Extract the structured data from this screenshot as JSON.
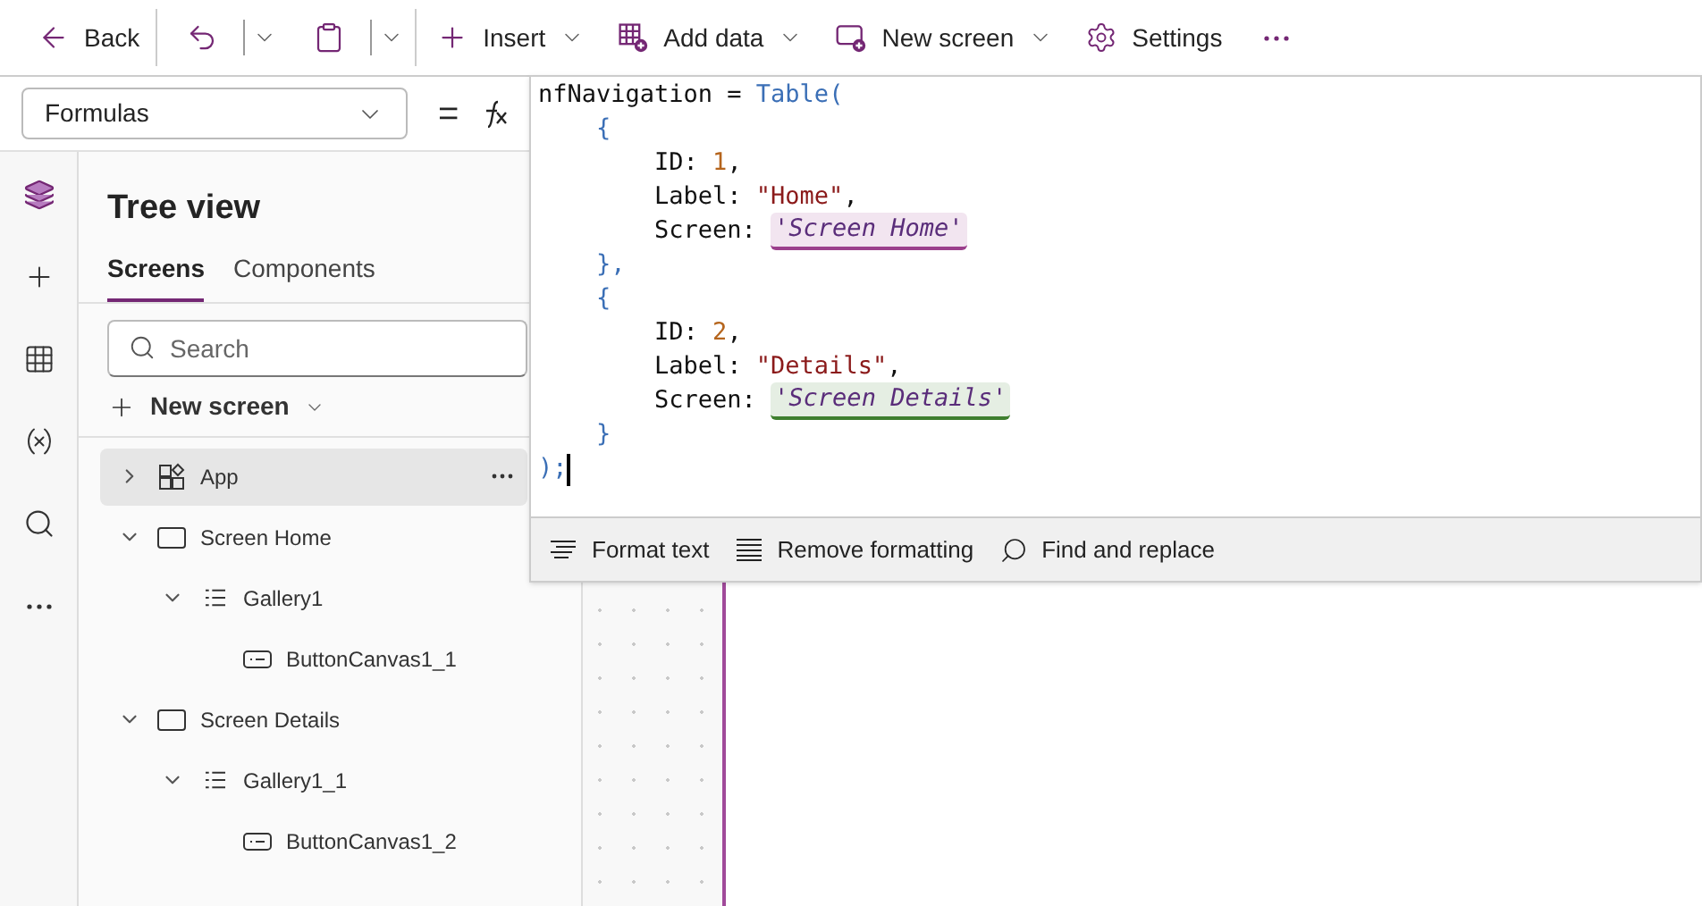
{
  "toolbar": [
    {
      "kind": "back",
      "label": "Back",
      "dropdown": false,
      "separator_after": true
    },
    {
      "kind": "undo",
      "dropdown": true,
      "separator_after": false
    },
    {
      "kind": "paste",
      "dropdown": true,
      "separator_after": true
    },
    {
      "kind": "insert",
      "label": "Insert",
      "dropdown": true,
      "separator_after": false
    },
    {
      "kind": "add_data",
      "label": "Add data",
      "dropdown": true,
      "separator_after": false
    },
    {
      "kind": "new_screen",
      "label": "New screen",
      "dropdown": true,
      "separator_after": false
    },
    {
      "kind": "settings",
      "label": "Settings",
      "dropdown": false,
      "separator_after": false
    },
    {
      "kind": "more",
      "dropdown": false,
      "separator_after": false
    }
  ],
  "formula_bar": {
    "property": "Formulas",
    "equals": "=",
    "code": [
      [
        {
          "kind": "ident",
          "text": "nfNavigation = "
        },
        {
          "kind": "function",
          "text": "Table"
        },
        {
          "kind": "function",
          "text": "("
        }
      ],
      [
        {
          "kind": "punct",
          "text": "    {"
        }
      ],
      [
        {
          "kind": "ident",
          "text": "        ID: "
        },
        {
          "kind": "number",
          "text": "1"
        },
        {
          "kind": "ident",
          "text": ","
        }
      ],
      [
        {
          "kind": "ident",
          "text": "        Label: "
        },
        {
          "kind": "string",
          "text": "\"Home\""
        },
        {
          "kind": "ident",
          "text": ","
        }
      ],
      [
        {
          "kind": "ident",
          "text": "        Screen: "
        },
        {
          "kind": "screen_ref",
          "text": "'Screen Home'",
          "color": "#9b3f8c"
        }
      ],
      [
        {
          "kind": "punct",
          "text": "    },"
        }
      ],
      [
        {
          "kind": "punct",
          "text": "    {"
        }
      ],
      [
        {
          "kind": "ident",
          "text": "        ID: "
        },
        {
          "kind": "number",
          "text": "2"
        },
        {
          "kind": "ident",
          "text": ","
        }
      ],
      [
        {
          "kind": "ident",
          "text": "        Label: "
        },
        {
          "kind": "string",
          "text": "\"Details\""
        },
        {
          "kind": "ident",
          "text": ","
        }
      ],
      [
        {
          "kind": "ident",
          "text": "        Screen: "
        },
        {
          "kind": "screen_ref",
          "text": "'Screen Details'",
          "color": "#3f7f2f"
        }
      ],
      [
        {
          "kind": "punct",
          "text": "    }"
        }
      ],
      [
        {
          "kind": "punct",
          "text": ");"
        }
      ]
    ],
    "actions": [
      {
        "kind": "format",
        "label": "Format text"
      },
      {
        "kind": "remove_format",
        "label": "Remove formatting"
      },
      {
        "kind": "find",
        "label": "Find and replace"
      }
    ]
  },
  "rail": [
    {
      "kind": "layers",
      "selected": true
    },
    {
      "kind": "insert",
      "selected": false
    },
    {
      "kind": "data",
      "selected": false
    },
    {
      "kind": "variables",
      "selected": false
    },
    {
      "kind": "search",
      "selected": false
    },
    {
      "kind": "more",
      "selected": false
    }
  ],
  "tree_view": {
    "title": "Tree view",
    "tabs": [
      {
        "label": "Screens",
        "selected": true
      },
      {
        "label": "Components",
        "selected": false
      }
    ],
    "search": {
      "placeholder": "Search"
    },
    "new_screen": "New screen",
    "items": [
      {
        "kind": "app",
        "label": "App",
        "selected": true,
        "expanded": false
      },
      {
        "kind": "screen",
        "label": "Screen Home",
        "selected": false,
        "expanded": true,
        "children": [
          {
            "kind": "gallery",
            "label": "Gallery1",
            "selected": false,
            "expanded": true,
            "children": [
              {
                "kind": "button",
                "label": "ButtonCanvas1_1",
                "selected": false
              }
            ]
          }
        ]
      },
      {
        "kind": "screen",
        "label": "Screen Details",
        "selected": false,
        "expanded": true,
        "children": [
          {
            "kind": "gallery",
            "label": "Gallery1_1",
            "selected": false,
            "expanded": true,
            "children": [
              {
                "kind": "button",
                "label": "ButtonCanvas1_2",
                "selected": false
              }
            ]
          }
        ]
      }
    ]
  }
}
